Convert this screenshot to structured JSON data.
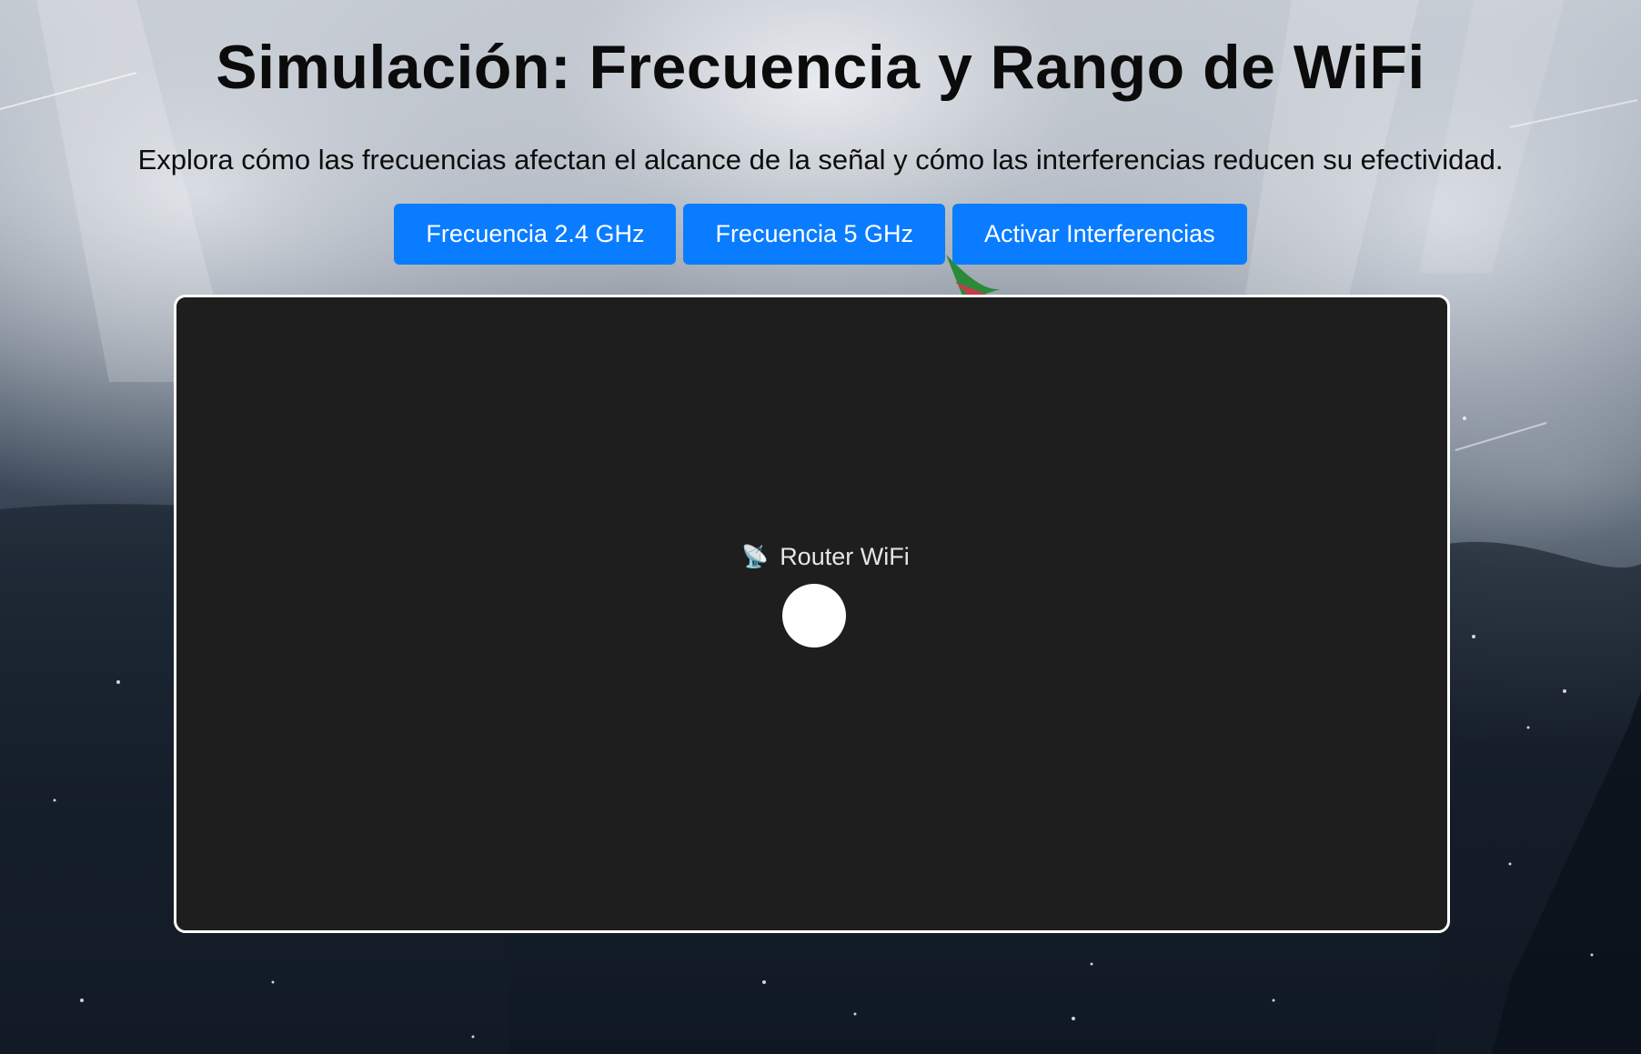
{
  "header": {
    "title": "Simulación: Frecuencia y Rango de WiFi",
    "subtitle": "Explora cómo las frecuencias afectan el alcance de la señal y cómo las interferencias reducen su efectividad."
  },
  "controls": {
    "btn_24": "Frecuencia 2.4 GHz",
    "btn_5": "Frecuencia 5 GHz",
    "btn_interference": "Activar Interferencias"
  },
  "simulation": {
    "router_label": "Router WiFi",
    "router_icon": "satellite-antenna-icon"
  },
  "colors": {
    "button": "#0a7cff",
    "panel": "#1e1e1e",
    "panel_border": "#ffffff"
  }
}
